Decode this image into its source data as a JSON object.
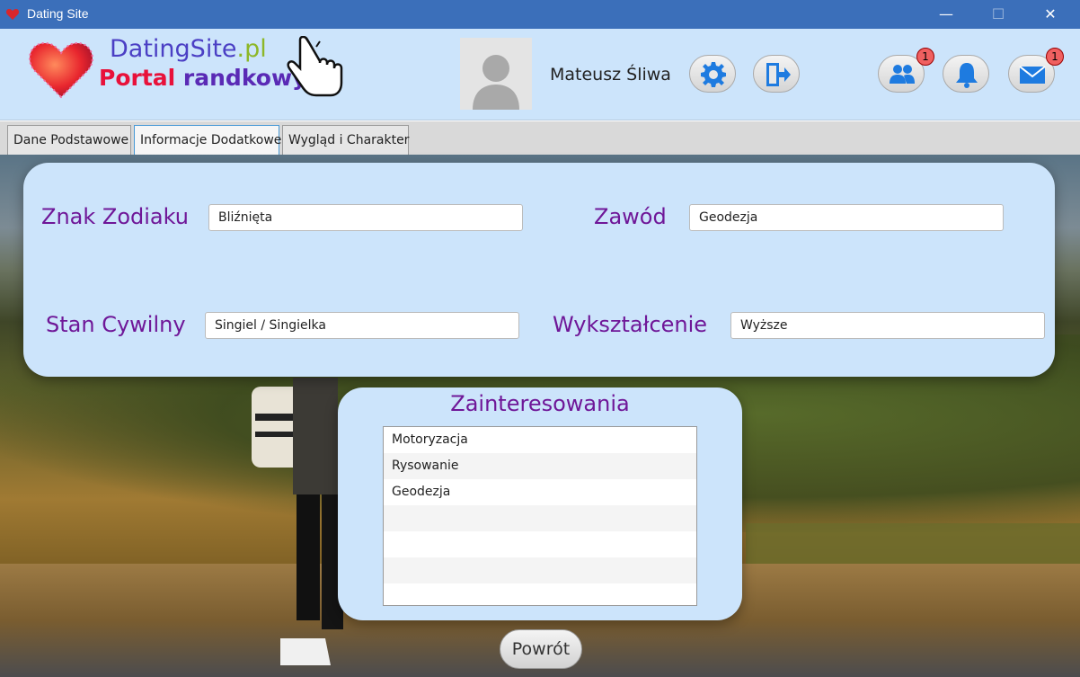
{
  "window": {
    "title": "Dating Site",
    "minimize": "—",
    "maximize": "☐",
    "close": "✕"
  },
  "header": {
    "logo_name": "DatingSite",
    "logo_tld": ".pl",
    "logo_sub_1": "Portal ",
    "logo_sub_2": "randkowy",
    "username": "Mateusz Śliwa",
    "friends_badge": "1",
    "messages_badge": "1"
  },
  "tabs": [
    {
      "label": "Dane Podstawowe",
      "active": false
    },
    {
      "label": "Informacje Dodatkowe",
      "active": true
    },
    {
      "label": "Wygląd i Charakter",
      "active": false
    }
  ],
  "form": {
    "zodiac_label": "Znak Zodiaku",
    "zodiac_value": "Bliźnięta",
    "job_label": "Zawód",
    "job_value": "Geodezja",
    "marital_label": "Stan Cywilny",
    "marital_value": "Singiel / Singielka",
    "education_label": "Wykształcenie",
    "education_value": "Wyższe"
  },
  "interests": {
    "title": "Zainteresowania",
    "items": [
      "Motoryzacja",
      "Rysowanie",
      "Geodezja",
      "",
      "",
      "",
      ""
    ]
  },
  "back_label": "Powrót",
  "colors": {
    "header_bg": "#cce4fb",
    "label_purple": "#6f1798",
    "icon_blue": "#1e7be0",
    "titlebar": "#3b6fba"
  }
}
